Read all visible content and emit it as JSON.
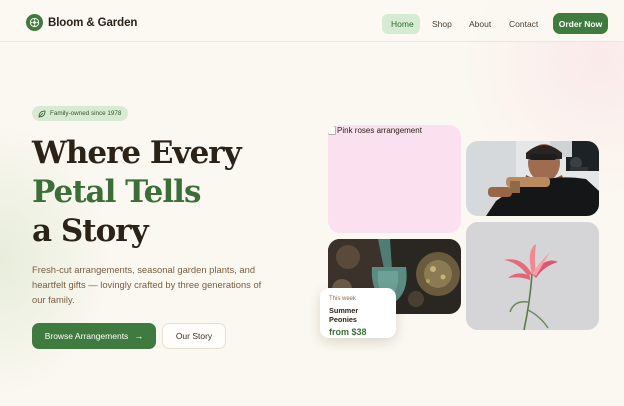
{
  "brand": {
    "name": "Bloom & Garden",
    "logo_icon": "flower-icon",
    "accent": "#3f7a3e"
  },
  "nav": {
    "items": [
      {
        "label": "Home",
        "active": true
      },
      {
        "label": "Shop",
        "active": false
      },
      {
        "label": "About",
        "active": false
      },
      {
        "label": "Contact",
        "active": false
      }
    ],
    "cta_label": "Order Now"
  },
  "hero": {
    "badge": "Family-owned since 1978",
    "badge_icon": "leaf-icon",
    "headline_line1": "Where Every",
    "headline_line2": "Petal Tells",
    "headline_line3": "a Story",
    "subtext": "Fresh-cut arrangements, seasonal garden plants, and heartfelt gifts — lovingly crafted by three generations of our family.",
    "primary_button": "Browse Arrangements",
    "primary_button_icon": "arrow-right-icon",
    "secondary_button": "Our Story"
  },
  "gallery": {
    "roses_alt": "Pink roses arrangement",
    "featured_card": {
      "label": "This week",
      "title": "Summer Peonies",
      "price": "from $38"
    }
  }
}
